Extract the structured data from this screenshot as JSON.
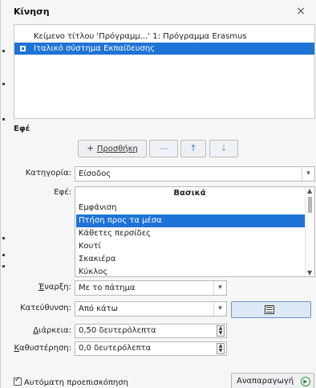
{
  "dialog": {
    "title": "Κίνηση",
    "close": "×"
  },
  "animation_list": [
    {
      "label": "Κείμενο τίτλου 'Πρόγραμμ...' 1: Πρόγραμμα Erasmus",
      "selected": false
    },
    {
      "label": "Ιταλικό σύστημα Εκπαίδευσης",
      "selected": true
    }
  ],
  "effect_section": {
    "heading": "Εφέ",
    "add_button": "Προσθήκη",
    "add_icon": "+",
    "remove_icon": "—",
    "move_up_icon": "↑",
    "move_down_icon": "↓"
  },
  "category": {
    "label": "Κατηγορία:",
    "value": "Είσοδος"
  },
  "effects": {
    "label": "Εφέ:",
    "group_header": "Βασικά",
    "items": [
      {
        "label": "Εμφάνιση",
        "selected": false
      },
      {
        "label": "Πτήση προς τα μέσα",
        "selected": true
      },
      {
        "label": "Κάθετες περσίδες",
        "selected": false
      },
      {
        "label": "Κουτί",
        "selected": false
      },
      {
        "label": "Σκακιέρα",
        "selected": false
      },
      {
        "label": "Κύκλος",
        "selected": false
      }
    ]
  },
  "start": {
    "label_u": "Έ",
    "label_rest": "ναρξη:",
    "value": "Με το πάτημα"
  },
  "direction": {
    "label": "Κατεύθυνση:",
    "value": "Από κάτω"
  },
  "duration": {
    "label_u": "Δ",
    "label_rest": "ιάρκεια:",
    "value": "0,50 δευτερόλεπτα"
  },
  "delay": {
    "label_u": "Κ",
    "label_rest": "αθυστέρηση:",
    "value": "0,0 δευτερόλεπτα"
  },
  "footer": {
    "autopreview_label": "Αυτόματη προεπισκόπηση",
    "autopreview_checked": true,
    "play_label": "Αναπαραγωγή"
  }
}
